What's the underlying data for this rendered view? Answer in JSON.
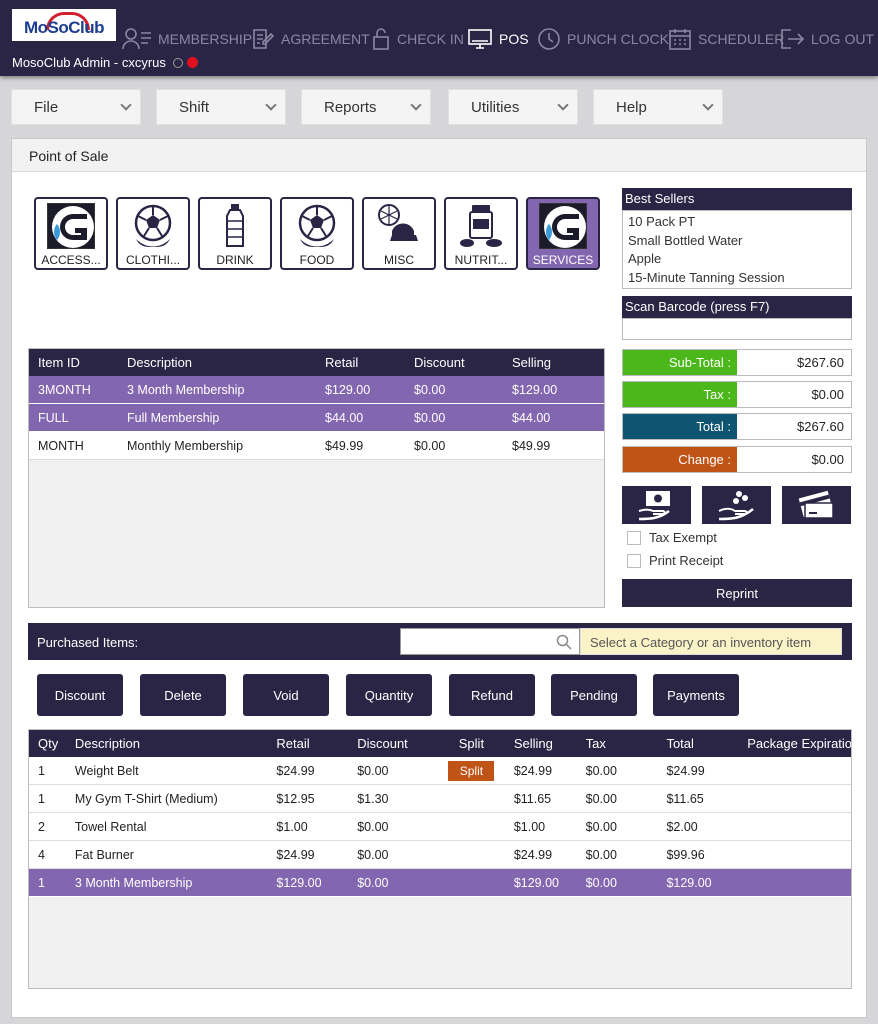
{
  "app": {
    "logo_text": "MoSoClub",
    "user": "MosoClub Admin - cxcyrus"
  },
  "nav": [
    {
      "label": "MEMBERSHIP",
      "icon": "membership-icon",
      "active": false
    },
    {
      "label": "AGREEMENT",
      "icon": "agreement-icon",
      "active": false
    },
    {
      "label": "CHECK IN",
      "icon": "lock-icon",
      "active": false
    },
    {
      "label": "POS",
      "icon": "monitor-icon",
      "active": true
    },
    {
      "label": "PUNCH CLOCK",
      "icon": "clock-icon",
      "active": false
    },
    {
      "label": "SCHEDULER",
      "icon": "calendar-icon",
      "active": false
    },
    {
      "label": "LOG OUT",
      "icon": "logout-icon",
      "active": false
    }
  ],
  "menu": [
    "File",
    "Shift",
    "Reports",
    "Utilities",
    "Help"
  ],
  "panel_title": "Point of Sale",
  "categories": [
    {
      "label": "ACCESS...",
      "icon": "club-logo-icon"
    },
    {
      "label": "CLOTHI...",
      "icon": "soccer-ball-icon"
    },
    {
      "label": "DRINK",
      "icon": "bottle-icon"
    },
    {
      "label": "FOOD",
      "icon": "soccer-ball-icon"
    },
    {
      "label": "MISC",
      "icon": "misc-icon"
    },
    {
      "label": "NUTRIT...",
      "icon": "supplement-icon"
    },
    {
      "label": "SERVICES",
      "icon": "club-logo-icon",
      "selected": true
    }
  ],
  "items_table": {
    "headers": [
      "Item ID",
      "Description",
      "Retail",
      "Discount",
      "Selling"
    ],
    "rows": [
      {
        "cells": [
          "3MONTH",
          "3 Month Membership",
          "$129.00",
          "$0.00",
          "$129.00"
        ],
        "selected": true
      },
      {
        "cells": [
          "FULL",
          "Full Membership",
          "$44.00",
          "$0.00",
          "$44.00"
        ],
        "selected": true
      },
      {
        "cells": [
          "MONTH",
          "Monthly Membership",
          "$49.99",
          "$0.00",
          "$49.99"
        ],
        "selected": false
      }
    ]
  },
  "best_sellers": {
    "title": "Best Sellers",
    "items": [
      "10 Pack PT",
      "Small Bottled Water",
      "Apple",
      "15-Minute Tanning Session"
    ]
  },
  "scan_barcode": {
    "label": "Scan Barcode (press F7)",
    "value": ""
  },
  "summary": [
    {
      "label": "Sub-Total :",
      "value": "$267.60",
      "color": "#4cb71a"
    },
    {
      "label": "Tax :",
      "value": "$0.00",
      "color": "#4cb71a"
    },
    {
      "label": "Total :",
      "value": "$267.60",
      "color": "#0f5470"
    },
    {
      "label": "Change :",
      "value": "$0.00",
      "color": "#c05417"
    }
  ],
  "payment_buttons": [
    "cash-payment-icon",
    "tip-icon",
    "card-payment-icon"
  ],
  "options": {
    "tax_exempt": "Tax Exempt",
    "print_receipt": "Print Receipt"
  },
  "reprint": "Reprint",
  "purchased": {
    "label": "Purchased Items:",
    "search_placeholder": "",
    "hint": "Select a Category or an inventory item"
  },
  "actions": [
    "Discount",
    "Delete",
    "Void",
    "Quantity",
    "Refund",
    "Pending",
    "Payments"
  ],
  "purchased_table": {
    "headers": [
      "Qty",
      "Description",
      "Retail",
      "Discount",
      "Split",
      "Selling",
      "Tax",
      "Total",
      "Package Expiration"
    ],
    "split_label": "Split",
    "rows": [
      {
        "cells": [
          "1",
          "Weight Belt",
          "$24.99",
          "$0.00",
          "",
          "$24.99",
          "$0.00",
          "$24.99",
          ""
        ],
        "split": true,
        "selected": false
      },
      {
        "cells": [
          "1",
          "My Gym T-Shirt (Medium)",
          "$12.95",
          "$1.30",
          "",
          "$11.65",
          "$0.00",
          "$11.65",
          ""
        ],
        "split": false,
        "selected": false
      },
      {
        "cells": [
          "2",
          "Towel Rental",
          "$1.00",
          "$0.00",
          "",
          "$1.00",
          "$0.00",
          "$2.00",
          ""
        ],
        "split": false,
        "selected": false
      },
      {
        "cells": [
          "4",
          "Fat Burner",
          "$24.99",
          "$0.00",
          "",
          "$24.99",
          "$0.00",
          "$99.96",
          ""
        ],
        "split": false,
        "selected": false
      },
      {
        "cells": [
          "1",
          "3 Month Membership",
          "$129.00",
          "$0.00",
          "",
          "$129.00",
          "$0.00",
          "$129.00",
          ""
        ],
        "split": false,
        "selected": true
      }
    ]
  }
}
